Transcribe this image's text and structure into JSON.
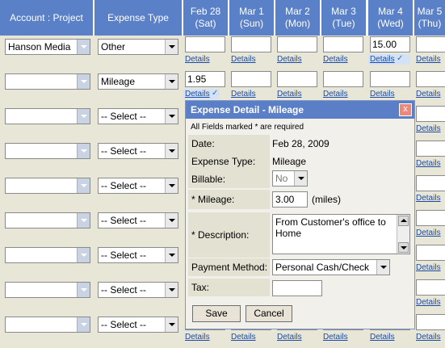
{
  "header": {
    "account_project": "Account : Project",
    "expense_type": "Expense Type",
    "days": [
      {
        "line1": "Feb 28",
        "line2": "(Sat)"
      },
      {
        "line1": "Mar 1",
        "line2": "(Sun)"
      },
      {
        "line1": "Mar 2",
        "line2": "(Mon)"
      },
      {
        "line1": "Mar 3",
        "line2": "(Tue)"
      },
      {
        "line1": "Mar 4",
        "line2": "(Wed)"
      },
      {
        "line1": "Mar 5",
        "line2": "(Thu)"
      }
    ]
  },
  "rows": [
    {
      "account": "Hanson Media",
      "expense_type": "Other",
      "amounts": [
        "",
        "",
        "",
        "",
        "15.00",
        ""
      ],
      "details": "Details",
      "checked_day": "Mar 4"
    },
    {
      "account": "",
      "expense_type": "Mileage",
      "amounts": [
        "1.95",
        "",
        "",
        "",
        "",
        ""
      ],
      "details": "Details",
      "checked_day": "Feb 28"
    },
    {
      "account": "",
      "expense_type": "-- Select --",
      "details": "Details"
    },
    {
      "account": "",
      "expense_type": "-- Select --",
      "details": "Details"
    },
    {
      "account": "",
      "expense_type": "-- Select --",
      "details": "Details"
    },
    {
      "account": "",
      "expense_type": "-- Select --",
      "details": "Details"
    },
    {
      "account": "",
      "expense_type": "-- Select --",
      "details": "Details"
    },
    {
      "account": "",
      "expense_type": "-- Select --",
      "details": "Details"
    },
    {
      "account": "",
      "expense_type": "-- Select --",
      "details": "Details"
    }
  ],
  "check_glyph": "✓",
  "dialog": {
    "title": "Expense Detail - Mileage",
    "close": "x",
    "note": "All Fields marked * are required",
    "date_label": "Date:",
    "date_value": "Feb 28, 2009",
    "type_label": "Expense Type:",
    "type_value": "Mileage",
    "billable_label": "Billable:",
    "billable_value": "No",
    "mileage_label": "* Mileage:",
    "mileage_value": "3.00",
    "mileage_unit": "(miles)",
    "description_label": "* Description:",
    "description_value": "From Customer's office to Home",
    "payment_label": "Payment Method:",
    "payment_value": "Personal Cash/Check",
    "tax_label": "Tax:",
    "tax_value": "",
    "save_label": "Save",
    "cancel_label": "Cancel"
  },
  "colors": {
    "header_bg": "#5a80c7",
    "row_bg": "#e8e6d7",
    "dialog_title_bg": "#5b7fc6",
    "close_bg": "#e98a7d",
    "link": "#1a4aa8"
  }
}
